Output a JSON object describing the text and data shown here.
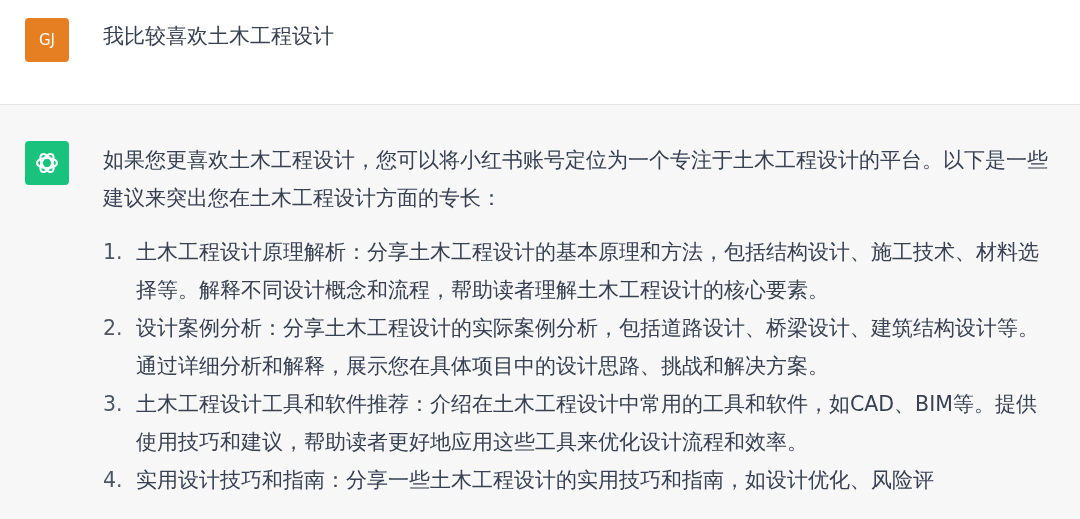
{
  "user_message": {
    "avatar": "GJ",
    "text": "我比较喜欢土木工程设计"
  },
  "assistant_message": {
    "intro": "如果您更喜欢土木工程设计，您可以将小红书账号定位为一个专注于土木工程设计的平台。以下是一些建议来突出您在土木工程设计方面的专长：",
    "items": [
      {
        "number": "1.",
        "text": "土木工程设计原理解析：分享土木工程设计的基本原理和方法，包括结构设计、施工技术、材料选择等。解释不同设计概念和流程，帮助读者理解土木工程设计的核心要素。"
      },
      {
        "number": "2.",
        "text": "设计案例分析：分享土木工程设计的实际案例分析，包括道路设计、桥梁设计、建筑结构设计等。通过详细分析和解释，展示您在具体项目中的设计思路、挑战和解决方案。"
      },
      {
        "number": "3.",
        "text": "土木工程设计工具和软件推荐：介绍在土木工程设计中常用的工具和软件，如CAD、BIM等。提供使用技巧和建议，帮助读者更好地应用这些工具来优化设计流程和效率。"
      },
      {
        "number": "4.",
        "text": "实用设计技巧和指南：分享一些土木工程设计的实用技巧和指南，如设计优化、风险评"
      }
    ]
  }
}
